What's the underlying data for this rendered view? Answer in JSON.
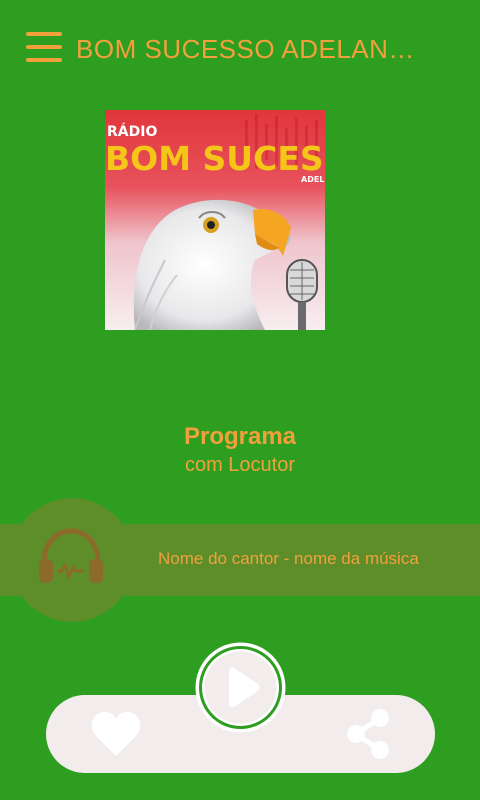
{
  "header": {
    "title": "BOM SUCESSO ADELANDIA",
    "menu_icon": "hamburger-menu-icon"
  },
  "cover": {
    "line1": "RÁDIO",
    "line2": "BOM SUCES",
    "line3": "ADEL",
    "icon": "eagle-microphone-logo"
  },
  "program": {
    "title": "Programa",
    "host": "com Locutor"
  },
  "now_playing": {
    "text": "Nome do cantor - nome da música",
    "icon": "headphones-icon"
  },
  "controls": {
    "favorite_icon": "heart-icon",
    "play_icon": "play-icon",
    "share_icon": "share-icon"
  },
  "colors": {
    "background": "#2e9e21",
    "accent": "#f2a03d",
    "band": "#5d8e2a",
    "control_bar": "#f3ecec"
  }
}
